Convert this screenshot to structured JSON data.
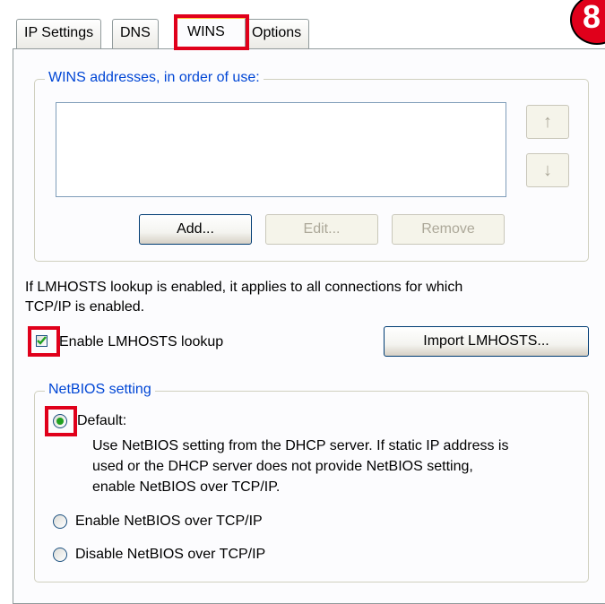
{
  "tabs": [
    {
      "label": "IP Settings"
    },
    {
      "label": "DNS"
    },
    {
      "label": "WINS"
    },
    {
      "label": "Options"
    }
  ],
  "active_tab": "WINS",
  "step_badge": "8",
  "wins_group": {
    "legend": "WINS addresses, in order of use:",
    "addresses": [],
    "up_icon": "↑",
    "down_icon": "↓",
    "add_label": "Add...",
    "edit_label": "Edit...",
    "remove_label": "Remove"
  },
  "lmhosts": {
    "info_line1": "If LMHOSTS lookup is enabled, it applies to all connections for which",
    "info_line2": "TCP/IP is enabled.",
    "checkbox_label": "Enable LMHOSTS lookup",
    "checkbox_checked": true,
    "import_label": "Import LMHOSTS..."
  },
  "netbios": {
    "legend": "NetBIOS setting",
    "default_label": "Default:",
    "default_desc_line1": "Use NetBIOS setting from the DHCP server. If static IP address is",
    "default_desc_line2": "used or the DHCP server does not provide NetBIOS setting,",
    "default_desc_line3": "enable NetBIOS over TCP/IP.",
    "enable_label": "Enable NetBIOS over TCP/IP",
    "disable_label": "Disable NetBIOS over TCP/IP",
    "selected": "default"
  },
  "colors": {
    "highlight_red": "#e0001b",
    "legend_blue": "#0046d5",
    "check_green": "#21a121"
  }
}
